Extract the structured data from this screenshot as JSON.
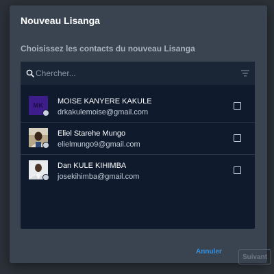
{
  "dialog": {
    "title": "Nouveau Lisanga",
    "subtitle": "Choisissez les contacts du nouveau Lisanga"
  },
  "search": {
    "placeholder": "Chercher..."
  },
  "icons": {
    "search": "search-icon",
    "filter": "filter-icon"
  },
  "contacts": [
    {
      "name": "MOISE KANYERE KAKULE",
      "email": "drkakulemoise@gmail.com",
      "avatar_initials": "MK",
      "avatar_color": "#3d1d8a",
      "selected": false
    },
    {
      "name": "Eliel Starehe Mungo",
      "email": "elielmungo9@gmail.com",
      "selected": false
    },
    {
      "name": "Dan KULE KIHIMBA",
      "email": "josekihimba@gmail.com",
      "selected": false
    }
  ],
  "actions": {
    "cancel_label": "Annuler",
    "next_label": "Suivant",
    "next_enabled": false
  },
  "colors": {
    "dialog_bg": "#3a4350",
    "panel_bg": "#0f1b2d",
    "accent": "#3c8fd4"
  }
}
